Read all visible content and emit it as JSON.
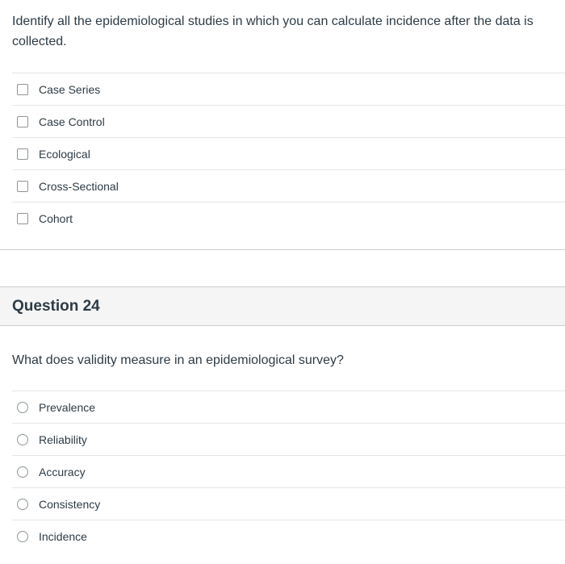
{
  "question_23": {
    "text": "Identify all the epidemiological studies in which you can calculate incidence after the data is collected.",
    "input_type": "checkbox",
    "answers": [
      {
        "label": "Case Series",
        "checked": false
      },
      {
        "label": "Case Control",
        "checked": false
      },
      {
        "label": "Ecological",
        "checked": false
      },
      {
        "label": "Cross-Sectional",
        "checked": false
      },
      {
        "label": "Cohort",
        "checked": false
      }
    ]
  },
  "question_24": {
    "header": "Question 24",
    "text": "What does validity measure in an epidemiological survey?",
    "input_type": "radio",
    "answers": [
      {
        "label": "Prevalence",
        "selected": false
      },
      {
        "label": "Reliability",
        "selected": false
      },
      {
        "label": "Accuracy",
        "selected": false
      },
      {
        "label": "Consistency",
        "selected": false
      },
      {
        "label": "Incidence",
        "selected": false
      }
    ]
  },
  "icons": {
    "checkbox": "checkbox-unchecked-icon",
    "radio": "radio-unselected-icon"
  },
  "colors": {
    "text": "#2d3b45",
    "header_background": "#f5f5f5",
    "divider": "#c7cdd1",
    "answer_divider": "#e6e6e6"
  }
}
